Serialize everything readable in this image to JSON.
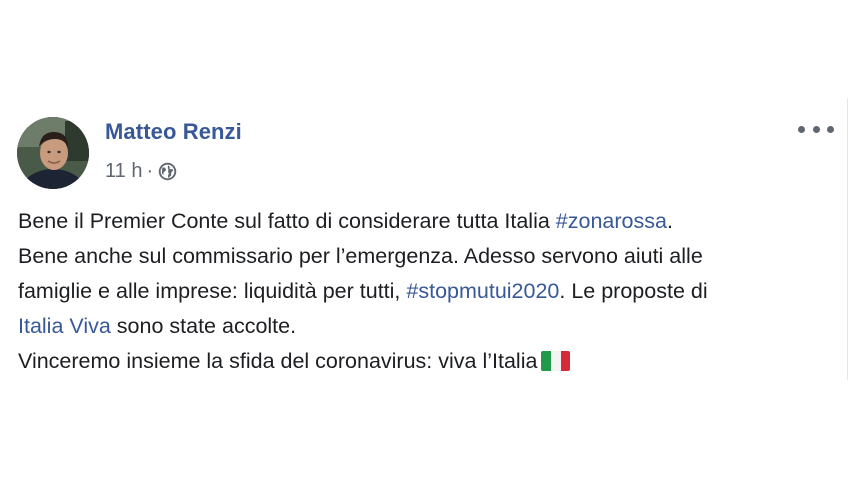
{
  "post": {
    "author": "Matteo Renzi",
    "timestamp": "11 h",
    "separator": "·",
    "audience_icon": "globe-icon",
    "menu_icon": "more-options-icon",
    "colors": {
      "link": "#385898",
      "text": "#1c1e21",
      "meta": "#606770"
    },
    "lines": [
      {
        "before": "Bene il Premier Conte sul fatto di considerare tutta Italia ",
        "tag": "#zonarossa",
        "after": "."
      },
      {
        "text": "Bene anche sul commissario per l’emergenza. Adesso servono aiuti alle"
      },
      {
        "before": "famiglie e alle imprese: liquidità per tutti, ",
        "tag": "#stopmutui2020",
        "after": ". Le proposte di"
      },
      {
        "link": "Italia Viva",
        "after": " sono state accolte."
      },
      {
        "text": "Vinceremo insieme la sfida del coronavirus: viva l’Italia",
        "emoji": "italy-flag-emoji"
      }
    ]
  }
}
